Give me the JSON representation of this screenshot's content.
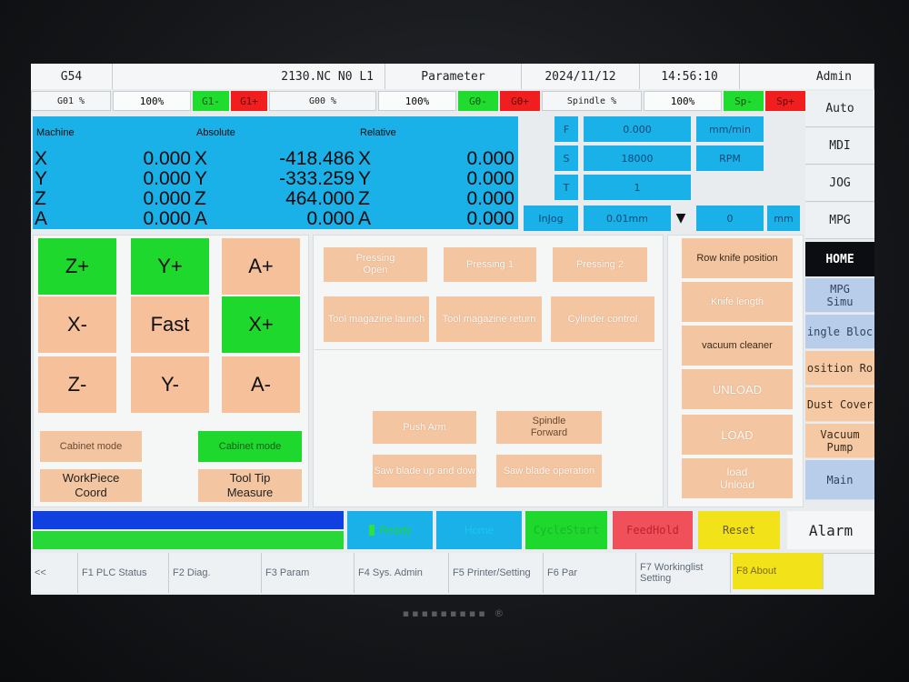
{
  "status": {
    "coord_system": "G54",
    "program": "2130.NC N0 L1",
    "page": "Parameter",
    "date": "2024/11/12",
    "time": "14:56:10",
    "user": "Admin"
  },
  "rates": {
    "g01_label": "G01 %",
    "g01_value": "100%",
    "g01_minus": "G1-",
    "g01_plus": "G1+",
    "g00_label": "G00 %",
    "g00_value": "100%",
    "g00_minus": "G0-",
    "g00_plus": "G0+",
    "spindle_label": "Spindle %",
    "spindle_value": "100%",
    "spindle_minus": "Sp-",
    "spindle_plus": "Sp+"
  },
  "coords": {
    "machine": {
      "title": "Machine",
      "x": "0.000",
      "y": "0.000",
      "z": "0.000",
      "a": "0.000"
    },
    "absolute": {
      "title": "Absolute",
      "x": "-418.486",
      "y": "-333.259",
      "z": "464.000",
      "a": "0.000"
    },
    "relative": {
      "title": "Relative",
      "x": "0.000",
      "y": "0.000",
      "z": "0.000",
      "a": "0.000"
    },
    "axes": {
      "x": "X",
      "y": "Y",
      "z": "Z",
      "a": "A"
    }
  },
  "fst": {
    "f_label": "F",
    "f_value": "0.000",
    "f_unit": "mm/min",
    "s_label": "S",
    "s_value": "18000",
    "s_unit": "RPM",
    "t_label": "T",
    "t_value": "1",
    "injog_label": "InJog",
    "step_value": "0.01mm",
    "dropdown_glyph": "▼",
    "offset_value": "0",
    "offset_unit": "mm"
  },
  "modes": {
    "auto": "Auto",
    "mdi": "MDI",
    "jog": "JOG",
    "mpg": "MPG",
    "home": "HOME",
    "mpg_simu_1": "MPG",
    "mpg_simu_2": "Simu",
    "single_block": "ingle Bloc",
    "position_ro": "osition Ro",
    "dust_cover": "Dust Cover",
    "vacuum_pump_1": "Vacuum",
    "vacuum_pump_2": "Pump",
    "main": "Main"
  },
  "jog": {
    "z_plus": "Z+",
    "y_plus": "Y+",
    "a_plus": "A+",
    "x_minus": "X-",
    "fast": "Fast",
    "x_plus": "X+",
    "z_minus": "Z-",
    "y_minus": "Y-",
    "a_minus": "A-"
  },
  "left_options": {
    "cabinet_mode_1": "Cabinet mode",
    "cabinet_mode_2": "Cabinet mode",
    "workpiece_1": "WorkPiece",
    "workpiece_2": "Coord",
    "tooltip_1": "Tool Tip",
    "tooltip_2": "Measure"
  },
  "center": {
    "pressing_open_1": "Pressing",
    "pressing_open_2": "Open",
    "pressing_1": "Pressing 1",
    "pressing_2": "Pressing 2",
    "tool_mag_launch": "Tool magazine launch",
    "tool_mag_return": "Tool magazine return",
    "cylinder": "Cylinder control",
    "push_arm": "Push Arm",
    "spindle_fwd_1": "Spindle",
    "spindle_fwd_2": "Forward",
    "saw_updown": "Saw blade up and dow",
    "saw_operation": "Saw blade operation"
  },
  "right_panel": {
    "row_knife": "Row knife position",
    "knife_length": "Knife length",
    "vacuum_cleaner": "vacuum cleaner",
    "unload": "UNLOAD",
    "load": "LOAD",
    "load_unload_1": "load",
    "load_unload_2": "Unload"
  },
  "controls": {
    "ready": "Ready",
    "home": "Home",
    "cycle_start": "CycleStart",
    "feed_hold": "FeedHold",
    "reset": "Reset",
    "alarm": "Alarm"
  },
  "fkeys": {
    "back": "<<",
    "f1": "F1 PLC Status",
    "f2": "F2 Diag.",
    "f3": "F3 Param",
    "f4": "F4 Sys. Admin",
    "f5": "F5 Printer/Setting",
    "f6": "F6 Par",
    "f7_1": "F7 Workinglist",
    "f7_2": "Setting",
    "f8": "F8 About"
  },
  "colors": {
    "coord_blue": "#1ab0e8",
    "jog_green": "#1fd82d",
    "jog_peach": "#f5c09a",
    "feed_red": "#f0505a",
    "reset_yellow": "#f2e21a",
    "progress_blue": "#1040e0",
    "progress_green": "#28d838"
  }
}
